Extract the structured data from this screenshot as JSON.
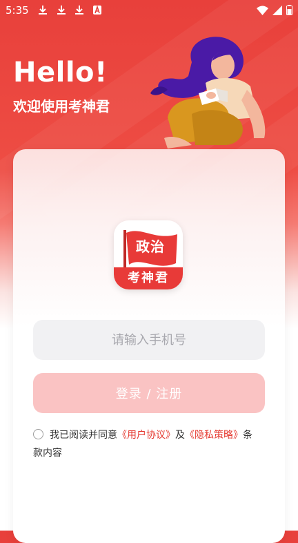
{
  "status_bar": {
    "time": "5:35",
    "icons": [
      "download-icon",
      "download-icon",
      "download-icon",
      "text-a-icon",
      "wifi-icon",
      "signal-icon",
      "battery-icon"
    ]
  },
  "header": {
    "greeting": "Hello!",
    "subtitle": "欢迎使用考神君"
  },
  "logo": {
    "flag_text": "政治",
    "bottom_text": "考神君"
  },
  "form": {
    "phone_placeholder": "请输入手机号",
    "phone_value": "",
    "login_label": "登录 / 注册"
  },
  "agreement": {
    "prefix": "我已阅读并同意",
    "user_agreement": "《用户协议》",
    "and": "及",
    "privacy_policy": "《隐私策略》",
    "suffix_line1": "条",
    "suffix_line2": "款内容",
    "checked": false
  },
  "colors": {
    "brand_red": "#e8403b",
    "link_red": "#e5382f",
    "button_disabled": "#fac3c3",
    "input_bg": "#f1f1f3"
  }
}
